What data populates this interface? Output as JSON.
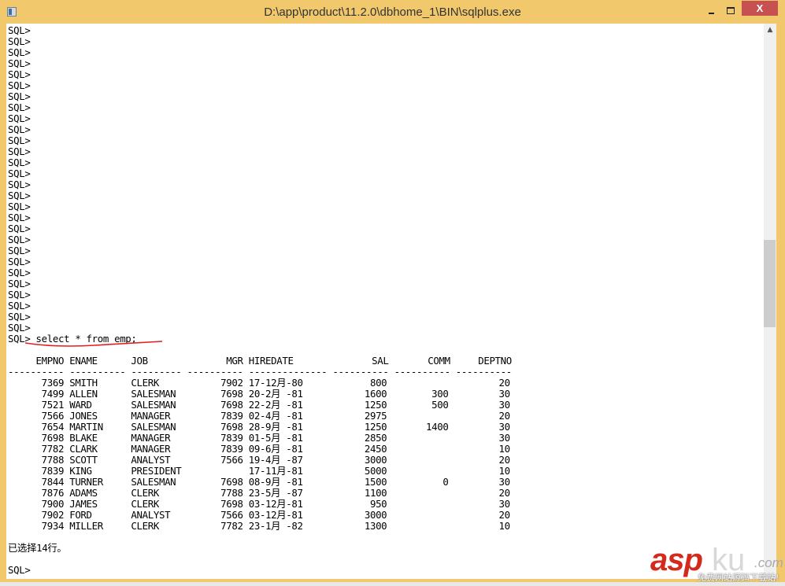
{
  "window": {
    "title": "D:\\app\\product\\11.2.0\\dbhome_1\\BIN\\sqlplus.exe",
    "controls": {
      "minimize": "minimize",
      "maximize": "maximize",
      "close": "X"
    },
    "accent_color": "#f1c86c",
    "close_color": "#c75050"
  },
  "console": {
    "empty_prompts": [
      "SQL>",
      "SQL>",
      "SQL>",
      "SQL>",
      "SQL>",
      "SQL>",
      "SQL>",
      "SQL>",
      "SQL>",
      "SQL>",
      "SQL>",
      "SQL>",
      "SQL>",
      "SQL>",
      "SQL>",
      "SQL>",
      "SQL>",
      "SQL>",
      "SQL>",
      "SQL>",
      "SQL>",
      "SQL>",
      "SQL>",
      "SQL>",
      "SQL>",
      "SQL>",
      "SQL>",
      "SQL>"
    ],
    "command_prompt": "SQL> ",
    "command": "select * from emp;",
    "annotation_color": "#e02020",
    "table": {
      "headers": [
        "EMPNO",
        "ENAME",
        "JOB",
        "MGR",
        "HIREDATE",
        "SAL",
        "COMM",
        "DEPTNO"
      ],
      "separator": "---------- ---------- --------- ---------- -------------- ---------- ---------- ----------",
      "rows": [
        [
          "7369",
          "SMITH",
          "CLERK",
          "7902",
          "17-12月-80",
          "800",
          "",
          "20"
        ],
        [
          "7499",
          "ALLEN",
          "SALESMAN",
          "7698",
          "20-2月 -81",
          "1600",
          "300",
          "30"
        ],
        [
          "7521",
          "WARD",
          "SALESMAN",
          "7698",
          "22-2月 -81",
          "1250",
          "500",
          "30"
        ],
        [
          "7566",
          "JONES",
          "MANAGER",
          "7839",
          "02-4月 -81",
          "2975",
          "",
          "20"
        ],
        [
          "7654",
          "MARTIN",
          "SALESMAN",
          "7698",
          "28-9月 -81",
          "1250",
          "1400",
          "30"
        ],
        [
          "7698",
          "BLAKE",
          "MANAGER",
          "7839",
          "01-5月 -81",
          "2850",
          "",
          "30"
        ],
        [
          "7782",
          "CLARK",
          "MANAGER",
          "7839",
          "09-6月 -81",
          "2450",
          "",
          "10"
        ],
        [
          "7788",
          "SCOTT",
          "ANALYST",
          "7566",
          "19-4月 -87",
          "3000",
          "",
          "20"
        ],
        [
          "7839",
          "KING",
          "PRESIDENT",
          "",
          "17-11月-81",
          "5000",
          "",
          "10"
        ],
        [
          "7844",
          "TURNER",
          "SALESMAN",
          "7698",
          "08-9月 -81",
          "1500",
          "0",
          "30"
        ],
        [
          "7876",
          "ADAMS",
          "CLERK",
          "7788",
          "23-5月 -87",
          "1100",
          "",
          "20"
        ],
        [
          "7900",
          "JAMES",
          "CLERK",
          "7698",
          "03-12月-81",
          "950",
          "",
          "30"
        ],
        [
          "7902",
          "FORD",
          "ANALYST",
          "7566",
          "03-12月-81",
          "3000",
          "",
          "20"
        ],
        [
          "7934",
          "MILLER",
          "CLERK",
          "7782",
          "23-1月 -82",
          "1300",
          "",
          "10"
        ]
      ]
    },
    "result_message": "已选择14行。",
    "final_prompt": "SQL>"
  },
  "scrollbar": {
    "up_arrow": "^",
    "position_fraction": 0.4
  },
  "watermark": {
    "brand_red": "asp",
    "brand_gray": "ku",
    "domain_suffix": ".com",
    "tagline": "免费网站源码下载站!"
  }
}
